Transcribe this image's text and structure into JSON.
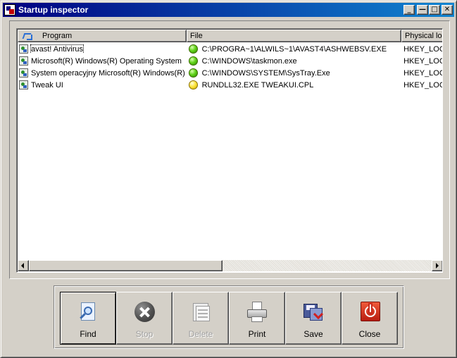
{
  "window": {
    "title": "Startup inspector",
    "controls": [
      "_",
      "—",
      "□",
      "✕"
    ]
  },
  "list": {
    "columns": {
      "program": "Program",
      "file": "File",
      "location": "Physical loc"
    },
    "rows": [
      {
        "program": "avast! Antivirus",
        "status": "green",
        "file": "C:\\PROGRA~1\\ALWILS~1\\AVAST4\\ASHWEBSV.EXE",
        "location": "HKEY_LOC"
      },
      {
        "program": "Microsoft(R) Windows(R) Operating System",
        "status": "green",
        "file": "C:\\WINDOWS\\taskmon.exe",
        "location": "HKEY_LOC"
      },
      {
        "program": "System operacyjny Microsoft(R) Windows(R)",
        "status": "green",
        "file": "C:\\WINDOWS\\SYSTEM\\SysTray.Exe",
        "location": "HKEY_LOC"
      },
      {
        "program": "Tweak UI",
        "status": "yellow",
        "file": "RUNDLL32.EXE TWEAKUI.CPL",
        "location": "HKEY_LOC"
      }
    ],
    "status_colors": {
      "green": "#3fb000",
      "yellow": "#ffe640"
    }
  },
  "toolbar": {
    "find": "Find",
    "stop": "Stop",
    "delete": "Delete",
    "print": "Print",
    "save": "Save",
    "close": "Close"
  },
  "icons": {
    "find": "find-icon",
    "stop": "stop-icon",
    "delete": "delete-icon",
    "print": "printer-icon",
    "save": "save-icon",
    "close": "power-icon"
  }
}
